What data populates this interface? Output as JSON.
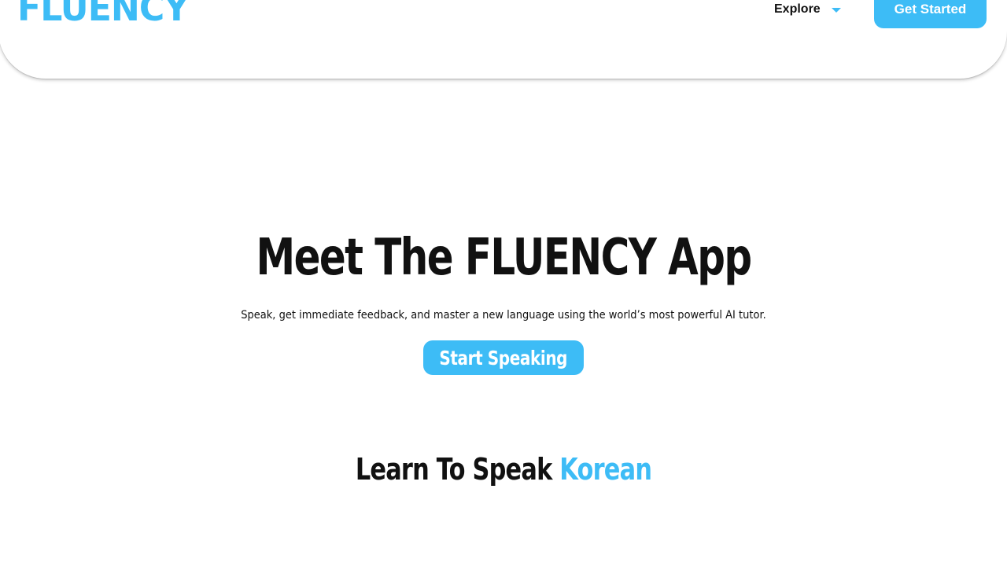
{
  "colors": {
    "accent": "#3dbcf6",
    "text": "#111111",
    "background": "#ffffff"
  },
  "header": {
    "logo_text": "FLUENCY",
    "explore_label": "Explore",
    "explore_icon": "caret-down-icon",
    "cta_label": "Get Started"
  },
  "hero": {
    "title": "Meet The FLUENCY App",
    "subtitle": "Speak, get immediate feedback, and master a new language using the world’s most powerful AI tutor.",
    "cta_label": "Start Speaking"
  },
  "learn": {
    "prefix": "Learn To Speak ",
    "language": "Korean"
  }
}
